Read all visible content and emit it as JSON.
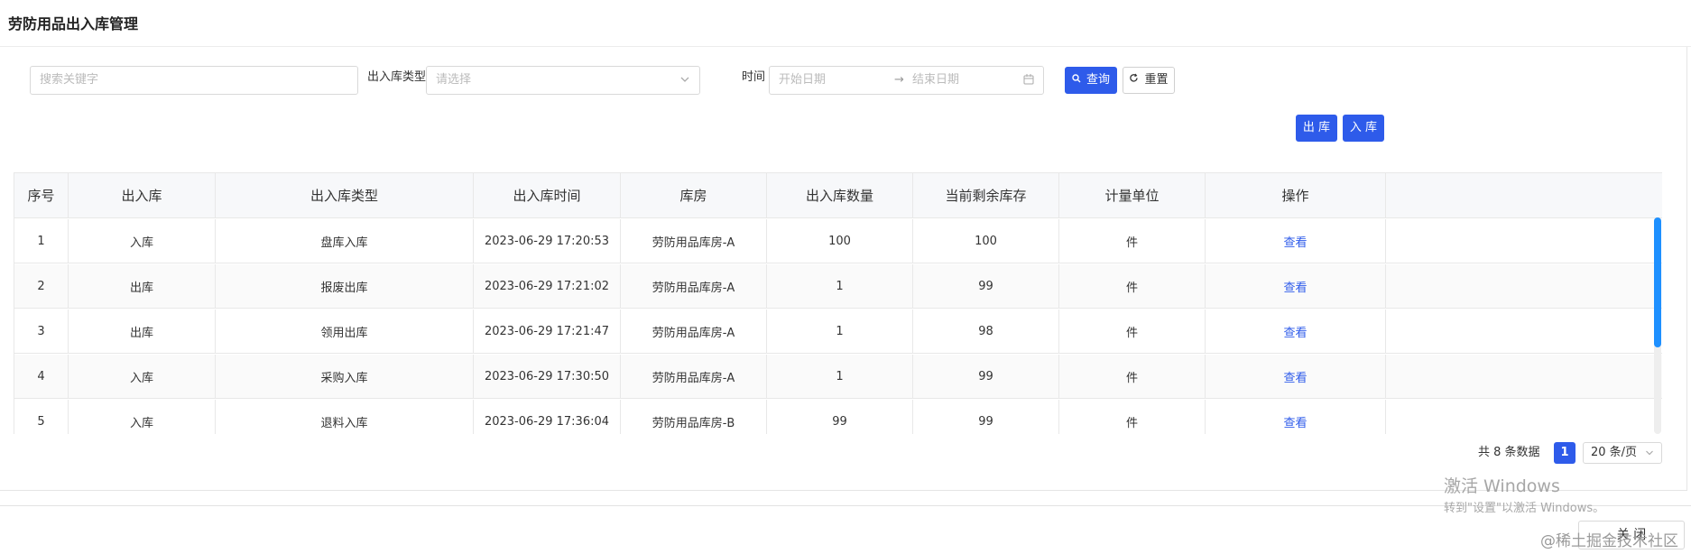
{
  "title": "劳防用品出入库管理",
  "filters": {
    "keyword_placeholder": "搜索关键字",
    "type_label": "出入库类型",
    "type_placeholder": "请选择",
    "time_label": "时间",
    "start_placeholder": "开始日期",
    "range_separator": "→",
    "end_placeholder": "结束日期",
    "query_label": "查询",
    "reset_label": "重置"
  },
  "actions": {
    "out_label": "出 库",
    "in_label": "入 库"
  },
  "table": {
    "headers": [
      "序号",
      "出入库",
      "出入库类型",
      "出入库时间",
      "库房",
      "出入库数量",
      "当前剩余库存",
      "计量单位",
      "操作"
    ],
    "rows": [
      [
        "1",
        "入库",
        "盘库入库",
        "2023-06-29 17:20:53",
        "劳防用品库房-A",
        "100",
        "100",
        "件",
        "查看"
      ],
      [
        "2",
        "出库",
        "报废出库",
        "2023-06-29 17:21:02",
        "劳防用品库房-A",
        "1",
        "99",
        "件",
        "查看"
      ],
      [
        "3",
        "出库",
        "领用出库",
        "2023-06-29 17:21:47",
        "劳防用品库房-A",
        "1",
        "98",
        "件",
        "查看"
      ],
      [
        "4",
        "入库",
        "采购入库",
        "2023-06-29 17:30:50",
        "劳防用品库房-A",
        "1",
        "99",
        "件",
        "查看"
      ],
      [
        "5",
        "入库",
        "退料入库",
        "2023-06-29 17:36:04",
        "劳防用品库房-B",
        "99",
        "99",
        "件",
        "查看"
      ]
    ]
  },
  "pagination": {
    "total_text": "共 8 条数据",
    "current_page": "1",
    "page_size": "20 条/页"
  },
  "footer": {
    "close_label": "关 闭"
  },
  "watermark": {
    "line1": "激活 Windows",
    "line2": "转到\"设置\"以激活 Windows。",
    "site": "@稀土掘金技术社区"
  },
  "colors": {
    "primary": "#2e5bea",
    "scrollbar": "#1e90ff"
  }
}
